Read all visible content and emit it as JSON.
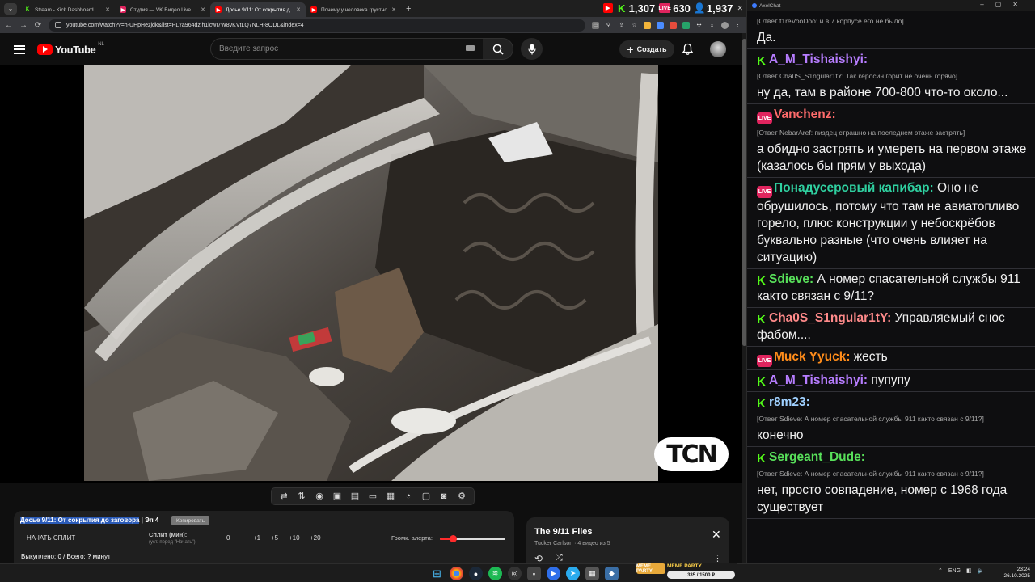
{
  "browser": {
    "tabs": [
      {
        "title": "Stream - Kick Dashboard",
        "color": "#53fc18",
        "glyph": "K"
      },
      {
        "title": "Студия — VK Видео Live",
        "color": "#e0245e",
        "glyph": "▶"
      },
      {
        "title": "Досье 9/11: От сокрытия д...",
        "color": "#ff0000",
        "glyph": "▶"
      },
      {
        "title": "Почему у человека грустно и...",
        "color": "#ff0000",
        "glyph": "▶"
      }
    ],
    "url": "youtube.com/watch?v=h-UHpHezjdk&list=PLYa964dzlh1lcwI7W8vKVtLQ7NLH-8ODL&index=4"
  },
  "viewer_stats": {
    "kick": "1,307",
    "vk": "630",
    "total": "1,937"
  },
  "youtube": {
    "logo_text": "YouTube",
    "country": "NL",
    "search_placeholder": "Введите запрос",
    "create_label": "Создать",
    "watermark": "TCN"
  },
  "split_panel": {
    "title_highlight": "Досье 9/11: От сокрытия до заговора",
    "title_rest": " | Эп 4",
    "copy_label": "Копировать",
    "start_label": "НАЧАТЬ СПЛИТ",
    "split_label": "Сплит (мин):",
    "split_sub": "(уст. перед \"Начать\")",
    "values": [
      "0",
      "+1",
      "+5",
      "+10",
      "+20"
    ],
    "alert_label": "Громк. алерта:",
    "alert_volume": 0.2,
    "bought": "Выкуплено: 0 / Всего: ? минут"
  },
  "playlist": {
    "title": "The 9/11 Files",
    "subtitle": "Tucker Carlson · 4 видео из 5"
  },
  "chat": {
    "window_title": "AxelChat",
    "messages": [
      {
        "platform": "",
        "user": "",
        "color": "",
        "reply": "[Ответ f1reVooDoo: и в 7 корпусе его не было]",
        "text": "Да."
      },
      {
        "platform": "kick",
        "user": "A_M_Tishaishyi:",
        "color": "#b77dff",
        "reply": "[Ответ Cha0S_S1ngular1tY: Так керосин горит не очень горячо]",
        "text": "ну да, там в районе 700-800 что-то около..."
      },
      {
        "platform": "vk",
        "user": "Vanchenz:",
        "color": "#ff6b6b",
        "reply": "[Ответ NebarAref: пиздец страшно на последнем этаже застрять]",
        "text": "а обидно застрять и умереть на первом этаже (казалось бы прям у выхода)"
      },
      {
        "platform": "vk",
        "user": "Понадусеровый капибар:",
        "color": "#2fd0a0",
        "reply": "",
        "text": "Оно не обрушилось, потому что там не авиатопливо горело, плюс конструкции у небоскрёбов буквально разные (что очень влияет на ситуацию)"
      },
      {
        "platform": "kick",
        "user": "Sdieve:",
        "color": "#58e05a",
        "reply": "",
        "text": "А номер спасательной службы 911 както связан с 9/11?"
      },
      {
        "platform": "kick",
        "user": "Cha0S_S1ngular1tY:",
        "color": "#ff8a8a",
        "reply": "",
        "text": "Управляемый снос фабом...."
      },
      {
        "platform": "vk",
        "user": "Muck Yyuck:",
        "color": "#ff8c1a",
        "reply": "",
        "text": "жесть"
      },
      {
        "platform": "kick",
        "user": "A_M_Tishaishyi:",
        "color": "#b77dff",
        "reply": "",
        "text": "пупупу"
      },
      {
        "platform": "kick",
        "user": "r8m23:",
        "color": "#9fd0ff",
        "reply": "[Ответ Sdieve: А номер спасательной службы 911 както связан с 9/11?]",
        "text": "конечно"
      },
      {
        "platform": "kick",
        "user": "Sergeant_Dude:",
        "color": "#58e05a",
        "reply": "[Ответ Sdieve: А номер спасательной службы 911 както связан с 9/11?]",
        "text": "нет, просто совпадение, номер с 1968 года существует"
      }
    ]
  },
  "taskbar": {
    "meme_badge": "MEME PARTY",
    "meme_title": "MEME PARTY",
    "meme_progress": "335 / 1500 ₽",
    "lang": "ENG",
    "time": "23:24",
    "date": "26.10.2025"
  },
  "colors": {
    "accent_red": "#ff0000",
    "kick_green": "#53fc18",
    "vk_pink": "#e0245e"
  }
}
